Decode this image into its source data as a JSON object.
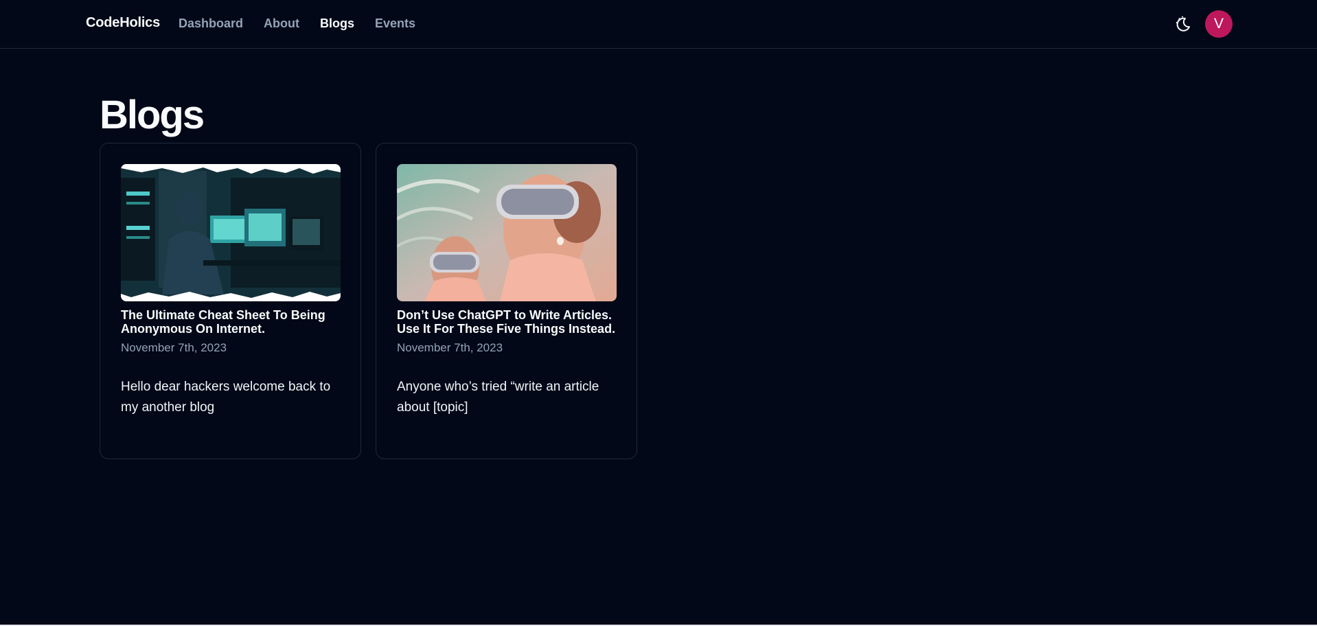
{
  "header": {
    "brand": "CodeHolics",
    "nav": [
      {
        "label": "Dashboard",
        "active": false
      },
      {
        "label": "About",
        "active": false
      },
      {
        "label": "Blogs",
        "active": true
      },
      {
        "label": "Events",
        "active": false
      }
    ],
    "theme_icon": "moon-stars-icon",
    "avatar_initial": "V",
    "avatar_color": "#be185d"
  },
  "main": {
    "title": "Blogs",
    "posts": [
      {
        "image_icon": "hacker-workstation-image",
        "title": "The Ultimate Cheat Sheet To Being Anonymous On Internet.",
        "date": "November 7th, 2023",
        "excerpt": "Hello dear hackers welcome back to my another blog"
      },
      {
        "image_icon": "vr-headset-women-image",
        "title": "Don’t Use ChatGPT to Write Articles. Use It For These Five Things Instead.",
        "date": "November 7th, 2023",
        "excerpt": "Anyone who’s tried “write an article about [topic]"
      }
    ]
  },
  "colors": {
    "background": "#020817",
    "border": "#1e293b",
    "muted_text": "#94a3b8",
    "text": "#f8fafc"
  }
}
